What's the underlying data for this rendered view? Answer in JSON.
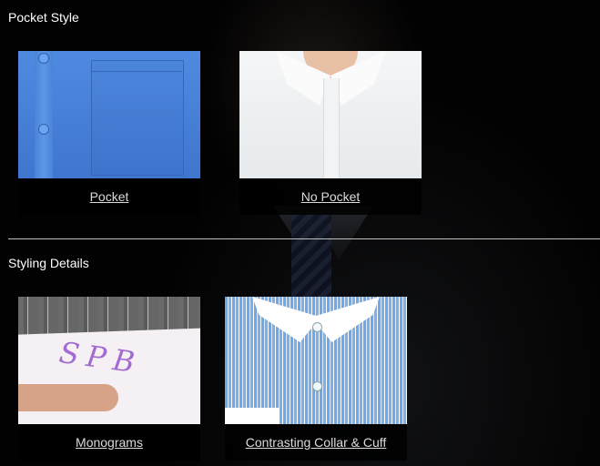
{
  "sections": {
    "pocket_style": {
      "title": "Pocket Style",
      "options": [
        {
          "label": "Pocket"
        },
        {
          "label": "No Pocket"
        }
      ]
    },
    "styling_details": {
      "title": "Styling Details",
      "options": [
        {
          "label": "Monograms",
          "monogram_text": "SPB"
        },
        {
          "label": "Contrasting Collar & Cuff"
        }
      ]
    }
  }
}
